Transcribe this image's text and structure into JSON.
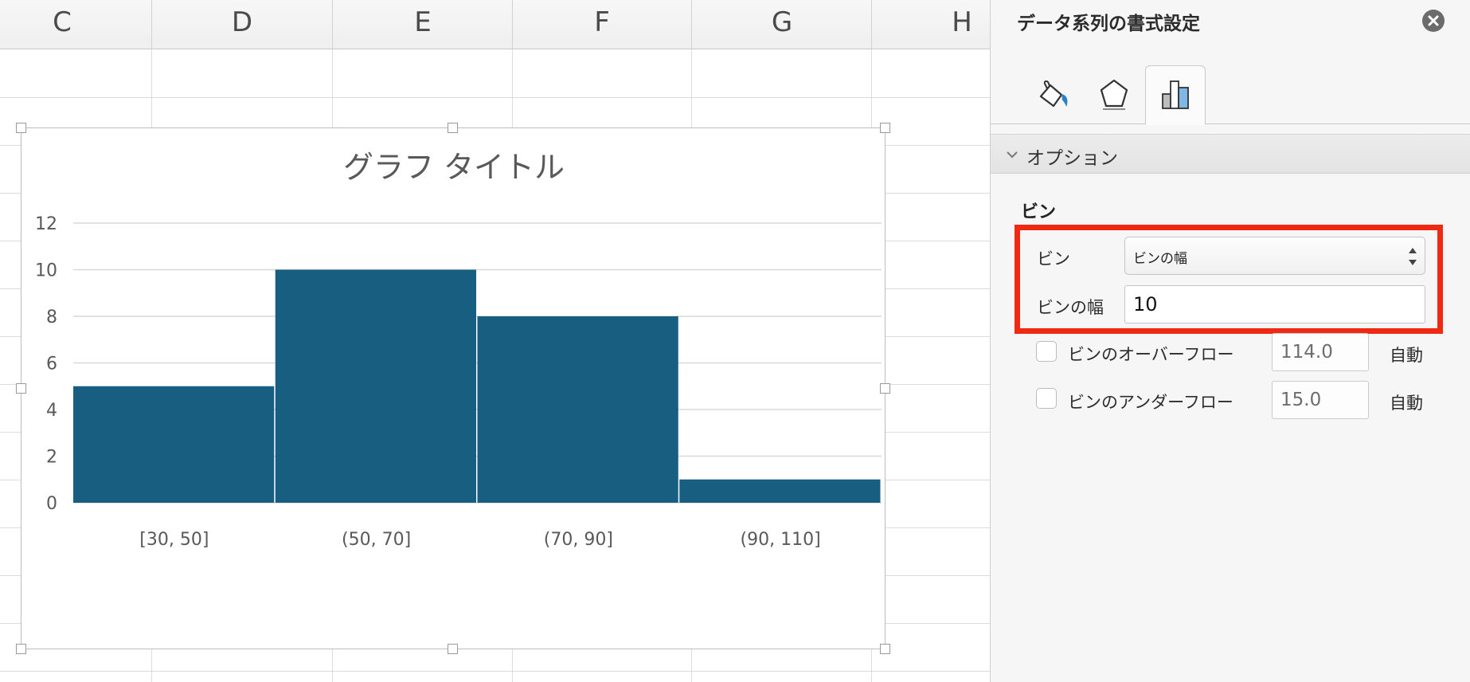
{
  "sheet": {
    "columns": [
      "C",
      "D",
      "E",
      "F",
      "G",
      "H"
    ]
  },
  "chart_data": {
    "type": "bar",
    "title": "グラフ タイトル",
    "categories": [
      "[30, 50]",
      "(50, 70]",
      "(70, 90]",
      "(90, 110]"
    ],
    "values": [
      5,
      10,
      8,
      1
    ],
    "xlabel": "",
    "ylabel": "",
    "ylim": [
      0,
      12
    ],
    "yticks": [
      "0",
      "2",
      "4",
      "6",
      "8",
      "10",
      "12"
    ],
    "grid": true,
    "bar_color": "#185e80"
  },
  "pane": {
    "title": "データ系列の書式設定",
    "close_icon": "close-icon",
    "tabs": [
      {
        "name": "fill-line",
        "icon": "paint-bucket-icon"
      },
      {
        "name": "effects",
        "icon": "pentagon-icon"
      },
      {
        "name": "series-options",
        "icon": "bar-chart-icon",
        "active": true
      }
    ],
    "section_title": "オプション",
    "bins": {
      "heading": "ビン",
      "type_label": "ビン",
      "type_value": "ビンの幅",
      "width_label": "ビンの幅",
      "width_value": "10",
      "overflow_label": "ビンのオーバーフロー",
      "overflow_value": "114.0",
      "underflow_label": "ビンのアンダーフロー",
      "underflow_value": "15.0",
      "auto_label": "自動"
    },
    "highlight_color": "#f02a12"
  }
}
